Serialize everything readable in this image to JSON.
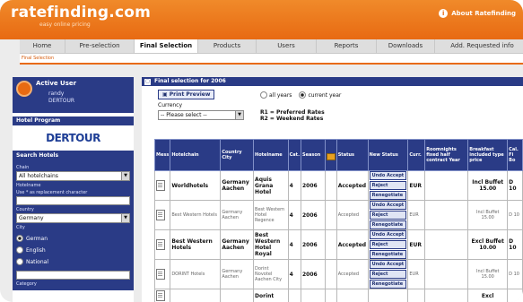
{
  "app": {
    "logo": "ratefinding.com",
    "tagline": "easy online pricing",
    "about_link": "About Ratefinding"
  },
  "tabs": [
    "Home",
    "Pre-selection",
    "Final Selection",
    "Products",
    "Users",
    "Reports",
    "Downloads",
    "Add. Requested info"
  ],
  "active_tab": "Final Selection",
  "subbar_text": "Final Selection",
  "sidebar": {
    "active_user_title": "Active User",
    "username": "randy",
    "user_sub": "DERTOUR",
    "hotel_program_title": "Hotel Program",
    "hotel_program_logo": "DERTOUR",
    "search_title": "Search Hotels",
    "chain_label": "Chain",
    "chain_value": "All hotelchains",
    "hotelname_label": "Hotelname",
    "hotelname_hint": "Use * as replacement character",
    "country_label": "Country",
    "country_value": "Germany",
    "city_label": "City",
    "lang_options": [
      "German",
      "English",
      "National"
    ],
    "category_label": "Category"
  },
  "main": {
    "title": "Final selection for 2006",
    "print_button": "Print Preview",
    "currency_label": "Currency",
    "currency_placeholder": "-- Please select --",
    "year_options": [
      "all years",
      "current year"
    ],
    "rates_legend": [
      "R1 = Preferred Rates",
      "R2 = Weekend Rates"
    ],
    "columns": [
      "Mess",
      "Hotelchain",
      "Country City",
      "Hotelname",
      "Cat.",
      "Season",
      "",
      "Status",
      "New Status",
      "Curr.",
      "Roomnights fixed half contract Year",
      "Breakfast included type price",
      "Cal. Fi Bo"
    ],
    "rows": [
      {
        "chain": "Worldhotels",
        "country": "Germany Aachen",
        "hotel": "Aquis Grana Hotel",
        "cat": "4",
        "season": "2006",
        "status": "Accepted",
        "actions": [
          "Undo Accept",
          "Reject",
          "Renegotiate"
        ],
        "curr": "EUR",
        "breakfast": "Incl Buffet 15.00",
        "extra": "D 10",
        "faint": false
      },
      {
        "chain": "Best Western Hotels",
        "country": "Germany Aachen",
        "hotel": "Best Western Hotel Regence",
        "cat": "4",
        "season": "2006",
        "status": "Accepted",
        "actions": [
          "Undo Accept",
          "Reject",
          "Renegotiate"
        ],
        "curr": "EUR",
        "breakfast": "Incl Buffet 15.00",
        "extra": "D 10",
        "faint": true
      },
      {
        "chain": "Best Western Hotels",
        "country": "Germany Aachen",
        "hotel": "Best Western Hotel Royal",
        "cat": "4",
        "season": "2006",
        "status": "Accepted",
        "actions": [
          "Undo Accept",
          "Reject",
          "Renegotiate"
        ],
        "curr": "EUR",
        "breakfast": "Excl Buffet 10.00",
        "extra": "D 10",
        "faint": false
      },
      {
        "chain": "DORINT Hotels",
        "country": "Germany Aachen",
        "hotel": "Dorint Novotel Aachen City",
        "cat": "4",
        "season": "2006",
        "status": "Accepted",
        "actions": [
          "Undo Accept",
          "Reject",
          "Renegotiate"
        ],
        "curr": "EUR",
        "breakfast": "Incl Buffet 15.00",
        "extra": "D 10",
        "faint": true
      },
      {
        "chain": "",
        "country": "",
        "hotel": "Dorint",
        "cat": "",
        "season": "",
        "status": "",
        "actions": [],
        "curr": "",
        "breakfast": "Excl",
        "extra": "",
        "faint": false
      }
    ]
  },
  "colors": {
    "orange": "#e86a12",
    "navy": "#2a3b86"
  }
}
